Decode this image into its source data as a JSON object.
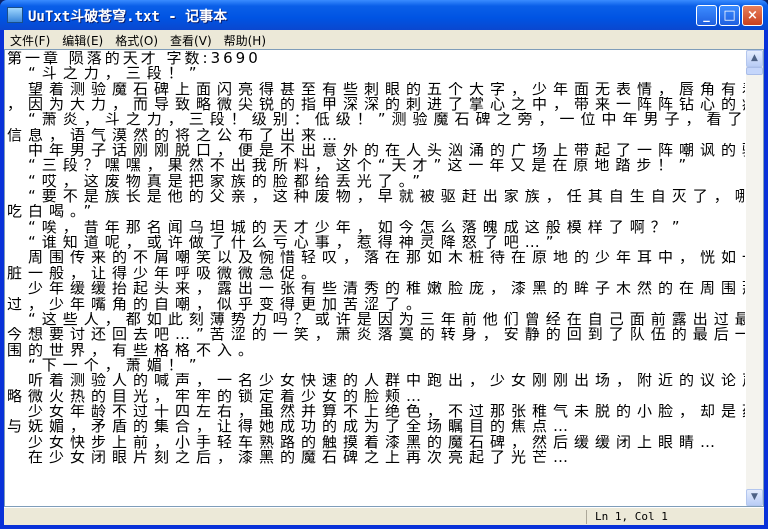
{
  "window": {
    "title": "UuTxt斗破苍穹.txt - 记事本",
    "minimize": "_",
    "maximize": "□",
    "close": "×"
  },
  "menu": [
    "文件(F)",
    "编辑(E)",
    "格式(O)",
    "查看(V)",
    "帮助(H)"
  ],
  "lines": [
    "第一章 陨落的天才 字数:3690",
    "　“斗之力，三段！”",
    "　望着测验魔石碑上面闪亮得甚至有些刺眼的五个大字，少年面无表情，唇角有着一抹自嘲，紧握的手掌",
    "，因为大力，而导致略微尖锐的指甲深深的刺进了掌心之中，带来一阵阵钻心的疼痛…",
    "　“萧炎，斗之力，三段！级别：低级！”测验魔石碑之旁，一位中年男子，看了一眼碑上所显示出来的",
    "信息，语气漠然的将之公布了出来…",
    "　中年男子话刚刚脱口，便是不出意外的在人头汹涌的广场上带起了一阵嘲讽的骚动。",
    "　“三段？嘿嘿，果然不出我所料，这个“天才”这一年又是在原地踏步！”",
    "　“哎，这废物真是把家族的脸都给丢光了。”",
    "　“要不是族长是他的父亲，这种废物，早就被驱赶出家族，任其自生自灭了，哪还有机会待在家族中白",
    "吃白喝。”",
    "　“唉，昔年那名闻乌坦城的天才少年，如今怎么落魄成这般模样了啊？”",
    "　“谁知道呢，或许做了什么亏心事，惹得神灵降怒了吧…”",
    "　周围传来的不屑嘲笑以及惋惜轻叹，落在那如木桩待在原地的少年耳中，恍如一根根利刺狠狠的扎在心",
    "脏一般，让得少年呼吸微微急促。",
    "　少年缓缓抬起头来，露出一张有些清秀的稚嫩脸庞，漆黑的眸子木然的在周围那些嘲讽的同龄人身上扫",
    "过，少年嘴角的自嘲，似乎变得更加苦涩了。",
    "　“这些人，都如此刻薄势力吗？或许是因为三年前他们曾经在自己面前露出过最谦卑的笑容，所以，如",
    "今想要讨还回去吧…”苦涩的一笑，萧炎落寞的转身，安静的回到了队伍的最后一排，孤单的身影，与周",
    "围的世界，有些格格不入。",
    "　“下一个，萧媚！”",
    "　听着测验人的喊声，一名少女快速的人群中跑出，少女刚刚出场，附近的议论声便是小了许多，一双双",
    "略微火热的目光，牢牢的锁定着少女的脸颊…",
    "　少女年龄不过十四左右，虽然并算不上绝色，不过那张稚气未脱的小脸，却是蕴含着淡淡的妩媚，清纯",
    "与妩媚，矛盾的集合，让得她成功的成为了全场瞩目的焦点…",
    "　少女快步上前，小手轻车熟路的触摸着漆黑的魔石碑，然后缓缓闭上眼睛…",
    "　在少女闭眼片刻之后，漆黑的魔石碑之上再次亮起了光芒…"
  ],
  "status": {
    "position": "Ln 1, Col 1"
  }
}
